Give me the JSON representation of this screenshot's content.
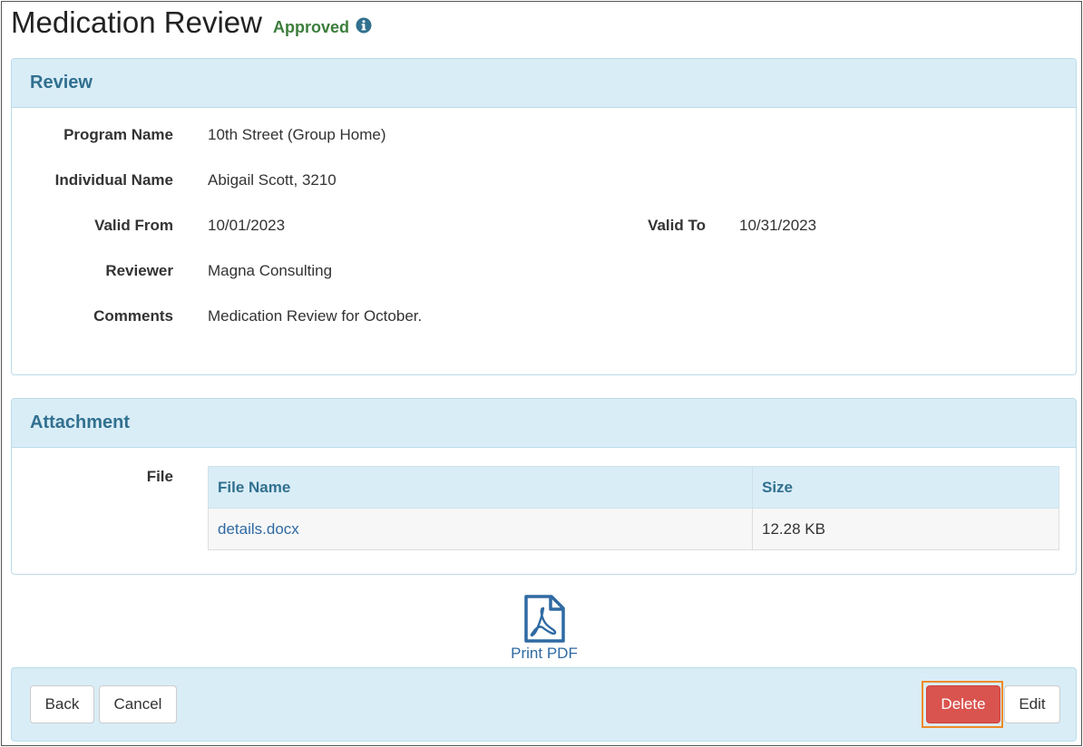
{
  "header": {
    "title": "Medication Review",
    "status": "Approved",
    "info_icon": "info-circle-icon",
    "status_color": "#3c7d3c"
  },
  "review": {
    "heading": "Review",
    "program_name_label": "Program Name",
    "program_name": "10th Street (Group Home)",
    "individual_name_label": "Individual Name",
    "individual_name": "Abigail Scott, 3210",
    "valid_from_label": "Valid From",
    "valid_from": "10/01/2023",
    "valid_to_label": "Valid To",
    "valid_to": "10/31/2023",
    "reviewer_label": "Reviewer",
    "reviewer": "Magna Consulting",
    "comments_label": "Comments",
    "comments": "Medication Review for October."
  },
  "attachment": {
    "heading": "Attachment",
    "file_label": "File",
    "columns": [
      "File Name",
      "Size"
    ],
    "rows": [
      {
        "file_name": "details.docx",
        "size": "12.28 KB"
      }
    ]
  },
  "print": {
    "label": "Print PDF",
    "icon": "pdf-file-icon"
  },
  "footer": {
    "back_label": "Back",
    "cancel_label": "Cancel",
    "delete_label": "Delete",
    "edit_label": "Edit"
  },
  "colors": {
    "panel_heading_bg": "#d9edf7",
    "panel_heading_text": "#31708f",
    "link": "#2f6aa3",
    "delete": "#d9534f",
    "highlight": "#ee8a2a"
  }
}
